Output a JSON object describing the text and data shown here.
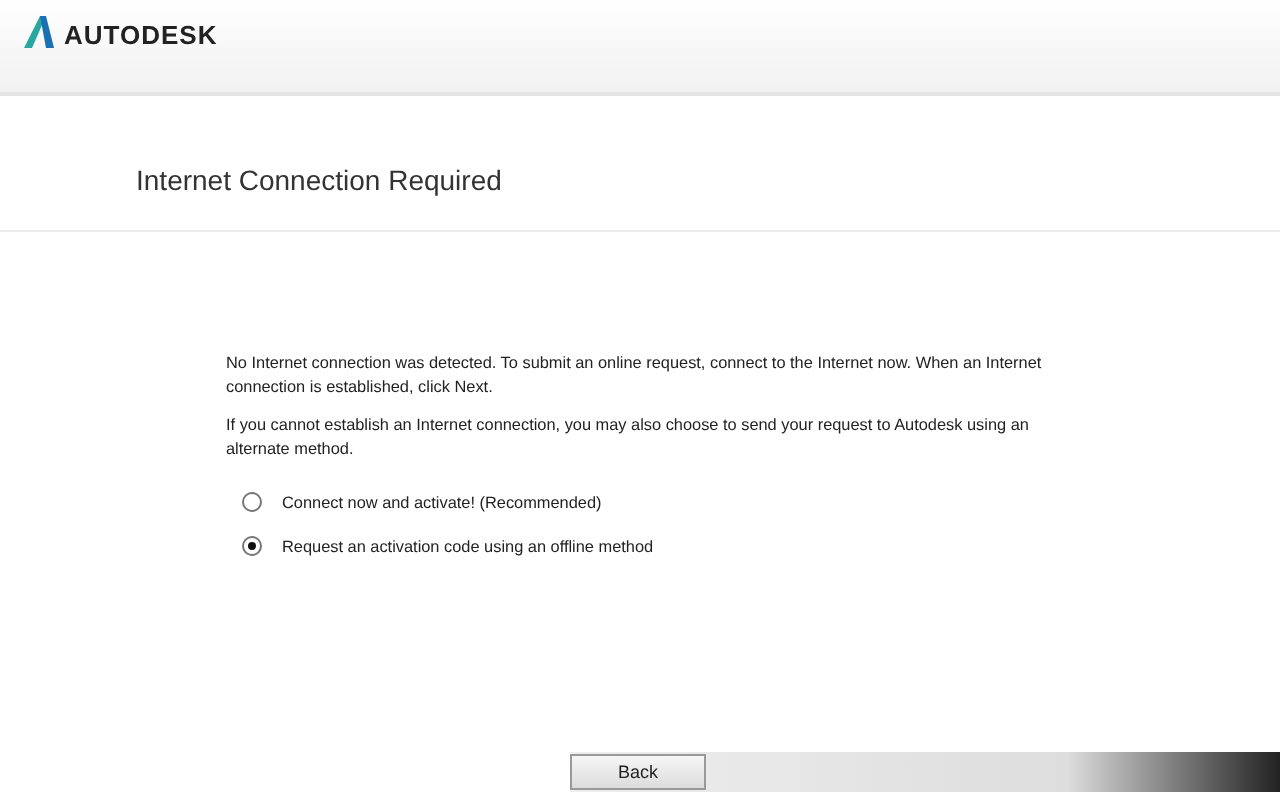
{
  "header": {
    "logo_text": "AUTODESK"
  },
  "title": "Internet Connection Required",
  "paragraphs": [
    "No Internet connection was detected. To submit an online request, connect to the Internet now. When an Internet connection is established, click Next.",
    "If you cannot establish an Internet connection, you may also choose to send your request to Autodesk using an alternate method."
  ],
  "options": [
    {
      "label": "Connect now and activate! (Recommended)",
      "selected": false
    },
    {
      "label": "Request an activation code using an offline method",
      "selected": true
    }
  ],
  "buttons": [
    {
      "label": "Back"
    }
  ]
}
